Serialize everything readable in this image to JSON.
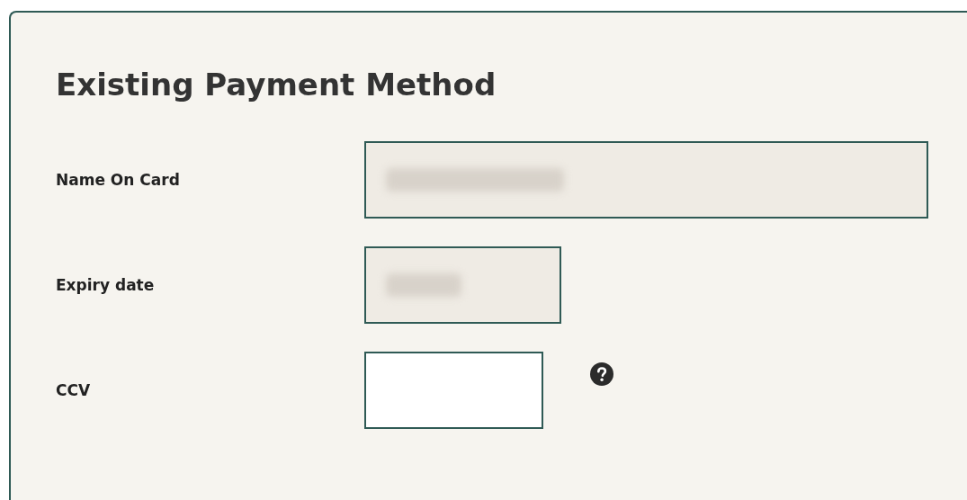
{
  "card": {
    "title": "Existing Payment Method"
  },
  "fields": [
    {
      "label": "Name On Card",
      "disabled": true,
      "redacted": true,
      "help": false
    },
    {
      "label": "Expiry date",
      "disabled": true,
      "redacted": true,
      "help": false
    },
    {
      "label": "CCV",
      "disabled": false,
      "redacted": false,
      "help": true
    }
  ]
}
